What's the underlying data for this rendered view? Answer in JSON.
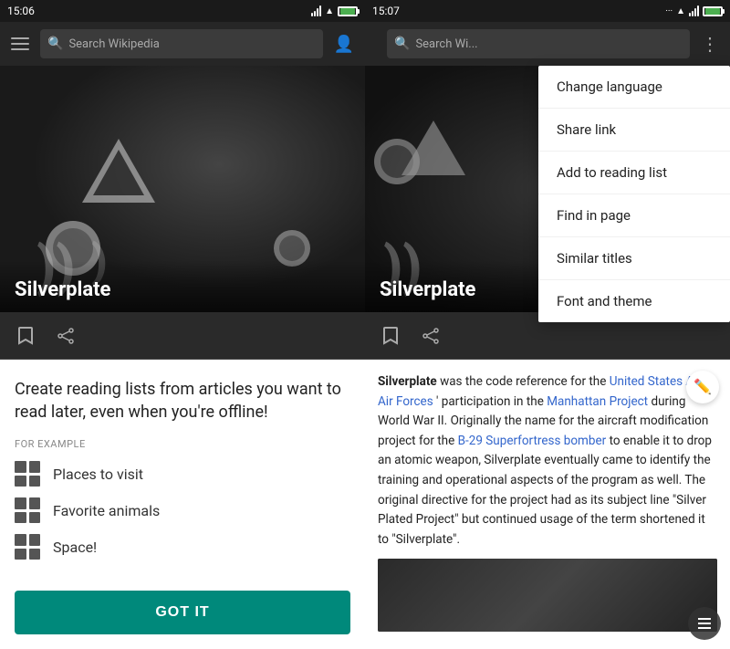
{
  "left_panel": {
    "status_bar": {
      "time": "15:06"
    },
    "toolbar": {
      "search_placeholder": "Search Wikipedia"
    },
    "hero": {
      "title": "Silverplate"
    },
    "promo": {
      "title": "Create reading lists from articles you want to read later, even when you're offline!",
      "for_example_label": "FOR EXAMPLE",
      "examples": [
        {
          "label": "Places to visit"
        },
        {
          "label": "Favorite animals"
        },
        {
          "label": "Space!"
        }
      ],
      "got_it_button": "GOT IT"
    }
  },
  "right_panel": {
    "status_bar": {
      "time": "15:07"
    },
    "toolbar": {
      "search_placeholder": "Search Wi..."
    },
    "hero": {
      "title": "Silverplate"
    },
    "dropdown_menu": {
      "items": [
        {
          "label": "Change language"
        },
        {
          "label": "Share link"
        },
        {
          "label": "Add to reading list"
        },
        {
          "label": "Find in page"
        },
        {
          "label": "Similar titles"
        },
        {
          "label": "Font and theme"
        }
      ]
    },
    "article": {
      "text_parts": [
        {
          "type": "bold",
          "text": "Silverplate"
        },
        {
          "type": "normal",
          "text": " was the code reference for the "
        },
        {
          "type": "link",
          "text": "United States Army Air Forces"
        },
        {
          "type": "normal",
          "text": "' participation in the "
        },
        {
          "type": "link",
          "text": "Manhattan Project"
        },
        {
          "type": "normal",
          "text": " during World War II. Originally the name for the aircraft modification project for the "
        },
        {
          "type": "link",
          "text": "B-29 Superfortress bomber"
        },
        {
          "type": "normal",
          "text": " to enable it to drop an atomic weapon, Silverplate eventually came to identify the training and operational aspects of the program as well. The original directive for the project had as its subject line \"Silver Plated Project\" but continued usage of the term shortened it to \"Silverplate\"."
        }
      ]
    }
  }
}
